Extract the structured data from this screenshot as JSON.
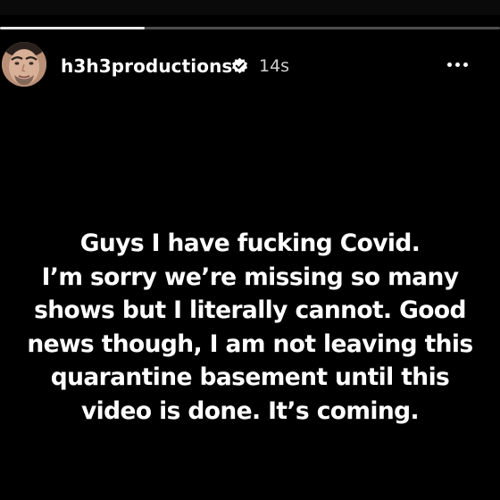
{
  "story": {
    "progress": 0.29,
    "user": {
      "username": "h3h3productions",
      "verified": true,
      "posted": "14s"
    },
    "icons": {
      "avatar": "profile-photo",
      "verified": "verified-badge-icon",
      "more": "more-horizontal-icon"
    },
    "caption_lines": [
      "Guys I have fucking Covid.",
      "I’m sorry we’re missing so many",
      "shows but I literally cannot. Good",
      "news though, I am not leaving this",
      "quarantine basement until this",
      "video is done. It’s coming."
    ]
  },
  "colors": {
    "background": "#000000",
    "text": "#ffffff",
    "muted_text": "#d0d0d0"
  }
}
